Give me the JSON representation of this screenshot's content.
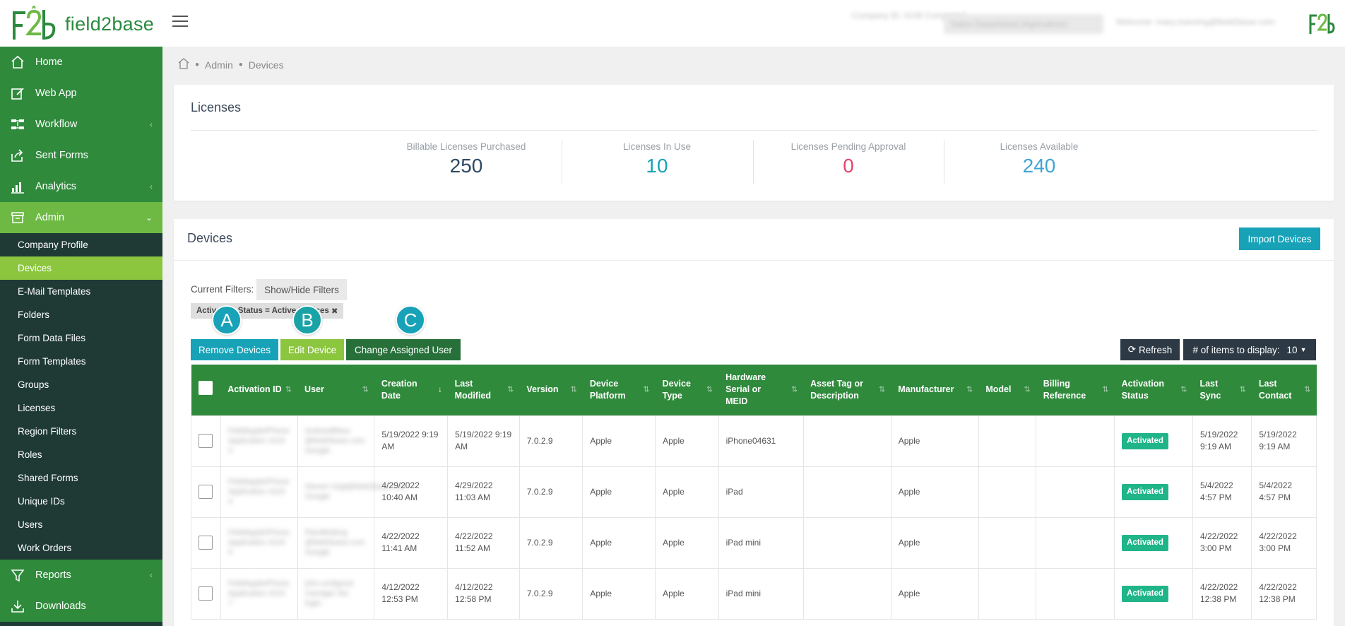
{
  "brand": {
    "name": "field2base",
    "logo_text": "field2base",
    "primary_green": "#2f8a3c",
    "accent_teal": "#17a2b8",
    "light_green": "#8cc63f"
  },
  "header": {
    "company_blurred": "Company ID: 4106 Company2",
    "select_blurred": "Sales Department (Agriculture)",
    "welcome_blurred": "Welcome: mary.manning@field2base.com"
  },
  "sidebar": {
    "main_items": [
      {
        "label": "Home",
        "icon": "home-icon"
      },
      {
        "label": "Web App",
        "icon": "edit-icon"
      },
      {
        "label": "Workflow",
        "icon": "workflow-icon",
        "chevron": "‹"
      },
      {
        "label": "Sent Forms",
        "icon": "send-icon"
      },
      {
        "label": "Analytics",
        "icon": "bar-chart-icon",
        "chevron": "‹"
      },
      {
        "label": "Admin",
        "icon": "archive-icon",
        "chevron": "⌄"
      }
    ],
    "admin_sub_items": [
      "Company Profile",
      "Devices",
      "E-Mail Templates",
      "Folders",
      "Form Data Files",
      "Form Templates",
      "Groups",
      "Licenses",
      "Region Filters",
      "Roles",
      "Shared Forms",
      "Unique IDs",
      "Users",
      "Work Orders"
    ],
    "bottom_items": [
      {
        "label": "Reports",
        "icon": "filter-icon",
        "chevron": "‹"
      },
      {
        "label": "Downloads",
        "icon": "download-icon"
      }
    ]
  },
  "breadcrumb": {
    "home_icon": "home-icon",
    "items": [
      "Admin",
      "Devices"
    ]
  },
  "licenses": {
    "title": "Licenses",
    "stats": [
      {
        "label": "Billable Licenses Purchased",
        "value": "250",
        "color": "#2f4a63"
      },
      {
        "label": "Licenses In Use",
        "value": "10",
        "color": "#17a2b8"
      },
      {
        "label": "Licenses Pending Approval",
        "value": "0",
        "color": "#e6436d"
      },
      {
        "label": "Licenses Available",
        "value": "240",
        "color": "#3fa4d6"
      }
    ]
  },
  "devices": {
    "title": "Devices",
    "import_button": "Import Devices",
    "current_filters_label": "Current Filters:",
    "show_hide_button": "Show/Hide Filters",
    "filter_chip": "Activation Status = Active Devices",
    "markers": [
      "A",
      "B",
      "C"
    ],
    "remove_button": "Remove Devices",
    "edit_button": "Edit Device",
    "change_user_button": "Change Assigned User",
    "refresh_button": "Refresh",
    "items_label": "# of items to display:",
    "items_value": "10",
    "columns": [
      "Activation ID",
      "User",
      "Creation Date",
      "Last Modified",
      "Version",
      "Device Platform",
      "Device Type",
      "Hardware Serial or MEID",
      "Asset Tag or Description",
      "Manufacturer",
      "Model",
      "Billing Reference",
      "Activation Status",
      "Last Sync",
      "Last Contact"
    ],
    "rows": [
      {
        "activation_id": "FieldAppleIPhone Application 4119 3",
        "user": "AndrewBlass @field2base.com Google",
        "creation": "5/19/2022 9:19 AM",
        "modified": "5/19/2022 9:19 AM",
        "version": "7.0.2.9",
        "platform": "Apple",
        "type": "Apple",
        "serial": "iPhone04631",
        "asset": "",
        "manufacturer": "Apple",
        "model": "",
        "billing": "",
        "status": "Activated",
        "sync": "5/19/2022 9:19 AM",
        "contact": "5/19/2022 9:19 AM"
      },
      {
        "activation_id": "FieldAppleIPhone Application 4119 4",
        "user": "Steven.Vogt@field2base.com Google",
        "creation": "4/29/2022 10:40 AM",
        "modified": "4/29/2022 11:03 AM",
        "version": "7.0.2.9",
        "platform": "Apple",
        "type": "Apple",
        "serial": "iPad",
        "asset": "",
        "manufacturer": "Apple",
        "model": "",
        "billing": "",
        "status": "Activated",
        "sync": "5/4/2022 4:57 PM",
        "contact": "5/4/2022 4:57 PM"
      },
      {
        "activation_id": "FieldAppleIPhone Application 4119 5",
        "user": "Plantfielding @field2base.com Google",
        "creation": "4/22/2022 11:41 AM",
        "modified": "4/22/2022 11:52 AM",
        "version": "7.0.2.9",
        "platform": "Apple",
        "type": "Apple",
        "serial": "iPad mini",
        "asset": "",
        "manufacturer": "Apple",
        "model": "",
        "billing": "",
        "status": "Activated",
        "sync": "4/22/2022 3:00 PM",
        "contact": "4/22/2022 3:00 PM"
      },
      {
        "activation_id": "FieldAppleIPhone Application 4119 7",
        "user": "john.smitgood manager the login",
        "creation": "4/12/2022 12:53 PM",
        "modified": "4/12/2022 12:58 PM",
        "version": "7.0.2.9",
        "platform": "Apple",
        "type": "Apple",
        "serial": "iPad mini",
        "asset": "",
        "manufacturer": "Apple",
        "model": "",
        "billing": "",
        "status": "Activated",
        "sync": "4/22/2022 12:38 PM",
        "contact": "4/22/2022 12:38 PM"
      }
    ]
  }
}
